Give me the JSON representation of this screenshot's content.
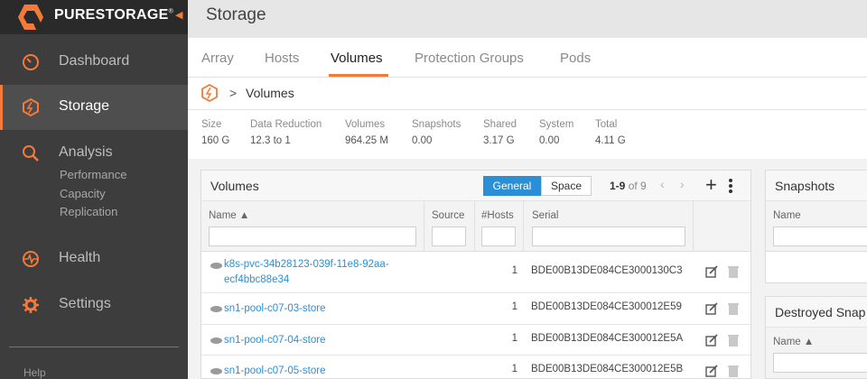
{
  "brand": {
    "name": "PURESTORAGE",
    "trademark": "®"
  },
  "page_title": "Storage",
  "sidebar": {
    "items": [
      {
        "label": "Dashboard",
        "icon": "dashboard-gauge-icon"
      },
      {
        "label": "Storage",
        "icon": "storage-hexagon-icon",
        "active": true
      },
      {
        "label": "Analysis",
        "icon": "analysis-magnifier-icon"
      },
      {
        "label": "Health",
        "icon": "health-pulse-icon"
      },
      {
        "label": "Settings",
        "icon": "settings-gear-icon"
      }
    ],
    "analysis_sub": [
      "Performance",
      "Capacity",
      "Replication"
    ],
    "help": "Help"
  },
  "tabs": [
    "Array",
    "Hosts",
    "Volumes",
    "Protection Groups",
    "Pods"
  ],
  "active_tab": "Volumes",
  "breadcrumb": {
    "separator": ">",
    "current": "Volumes"
  },
  "stats": [
    {
      "label": "Size",
      "value": "160 G"
    },
    {
      "label": "Data Reduction",
      "value": "12.3 to 1"
    },
    {
      "label": "Volumes",
      "value": "964.25 M"
    },
    {
      "label": "Snapshots",
      "value": "0.00"
    },
    {
      "label": "Shared",
      "value": "3.17 G"
    },
    {
      "label": "System",
      "value": "0.00"
    },
    {
      "label": "Total",
      "value": "4.11 G"
    }
  ],
  "volumes_panel": {
    "title": "Volumes",
    "view_general": "General",
    "view_space": "Space",
    "pager_range": "1-9",
    "pager_of": "of 9",
    "columns": {
      "name": "Name ▲",
      "source": "Source",
      "hosts": "#Hosts",
      "serial": "Serial"
    },
    "rows": [
      {
        "name": "k8s-pvc-34b28123-039f-11e8-92aa-ecf4bbc88e34",
        "hosts": "1",
        "serial": "BDE00B13DE084CE3000130C3"
      },
      {
        "name": "sn1-pool-c07-03-store",
        "hosts": "1",
        "serial": "BDE00B13DE084CE300012E59"
      },
      {
        "name": "sn1-pool-c07-04-store",
        "hosts": "1",
        "serial": "BDE00B13DE084CE300012E5A"
      },
      {
        "name": "sn1-pool-c07-05-store",
        "hosts": "1",
        "serial": "BDE00B13DE084CE300012E5B"
      }
    ]
  },
  "snapshots_panel": {
    "title": "Snapshots",
    "col_name": "Name"
  },
  "destroyed_panel": {
    "title": "Destroyed Snap",
    "col_name": "Name ▲"
  },
  "colors": {
    "accent": "#f47a3b",
    "link": "#2b8fd6",
    "sidebar": "#3d3d3d"
  }
}
